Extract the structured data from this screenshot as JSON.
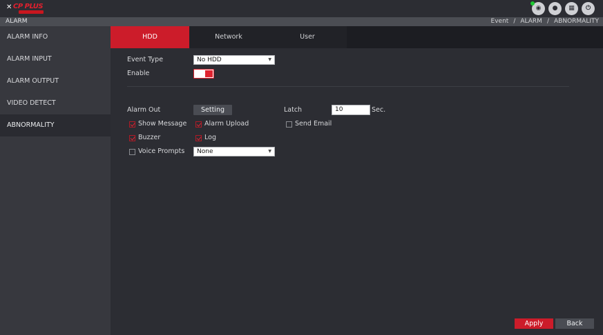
{
  "app": {
    "logo_text": "CP PLUS",
    "top_icons": [
      "eye-icon",
      "user-icon",
      "grid-icon",
      "power-icon"
    ]
  },
  "titlebar": {
    "title": "ALARM",
    "breadcrumb": [
      "Event",
      "ALARM",
      "ABNORMALITY"
    ]
  },
  "sidebar": {
    "items": [
      {
        "label": "ALARM INFO",
        "active": false
      },
      {
        "label": "ALARM INPUT",
        "active": false
      },
      {
        "label": "ALARM OUTPUT",
        "active": false
      },
      {
        "label": "VIDEO DETECT",
        "active": false
      },
      {
        "label": "ABNORMALITY",
        "active": true
      }
    ]
  },
  "tabs": [
    {
      "label": "HDD",
      "active": true
    },
    {
      "label": "Network",
      "active": false
    },
    {
      "label": "User",
      "active": false
    }
  ],
  "form": {
    "event_type_label": "Event Type",
    "event_type_value": "No HDD",
    "enable_label": "Enable",
    "enable_on": true,
    "alarm_out_label": "Alarm Out",
    "setting_label": "Setting",
    "latch_label": "Latch",
    "latch_value": "10",
    "latch_unit": "Sec.",
    "show_message": {
      "label": "Show Message",
      "checked": true
    },
    "alarm_upload": {
      "label": "Alarm Upload",
      "checked": true
    },
    "send_email": {
      "label": "Send Email",
      "checked": false
    },
    "buzzer": {
      "label": "Buzzer",
      "checked": true
    },
    "log": {
      "label": "Log",
      "checked": true
    },
    "voice_prompts": {
      "label": "Voice Prompts",
      "checked": false
    },
    "voice_prompts_value": "None"
  },
  "footer": {
    "apply_label": "Apply",
    "back_label": "Back"
  },
  "colors": {
    "accent": "#cc1c2a",
    "background": "#2c2d33",
    "sidebar": "#37383e"
  }
}
